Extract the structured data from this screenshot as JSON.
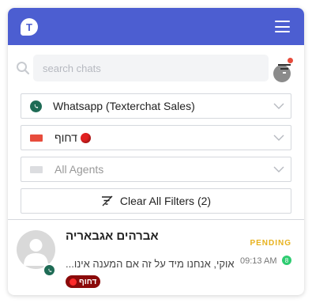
{
  "header": {
    "logo_letter": "T",
    "accent_color": "#4c5ed1"
  },
  "search": {
    "placeholder": "search chats",
    "value": ""
  },
  "filters": {
    "channel": {
      "label": "Whatsapp (Texterchat Sales)",
      "icon": "whatsapp-icon"
    },
    "tag": {
      "label": "דחוף",
      "color": "#e74c3c",
      "icon": "red-circle-emoji"
    },
    "agents": {
      "label": "All Agents",
      "icon": "agent-flag-icon"
    },
    "clear_label": "Clear All Filters (2)"
  },
  "chats": [
    {
      "name": "אברהים אגבאריה",
      "status": "PENDING",
      "status_color": "#e8b21c",
      "preview": "אוקי, אנחנו מיד על זה אם המענה אינו...",
      "time": "09:13 AM",
      "unread": "8",
      "tag": "דחוף",
      "channel_icon": "whatsapp-icon"
    }
  ]
}
